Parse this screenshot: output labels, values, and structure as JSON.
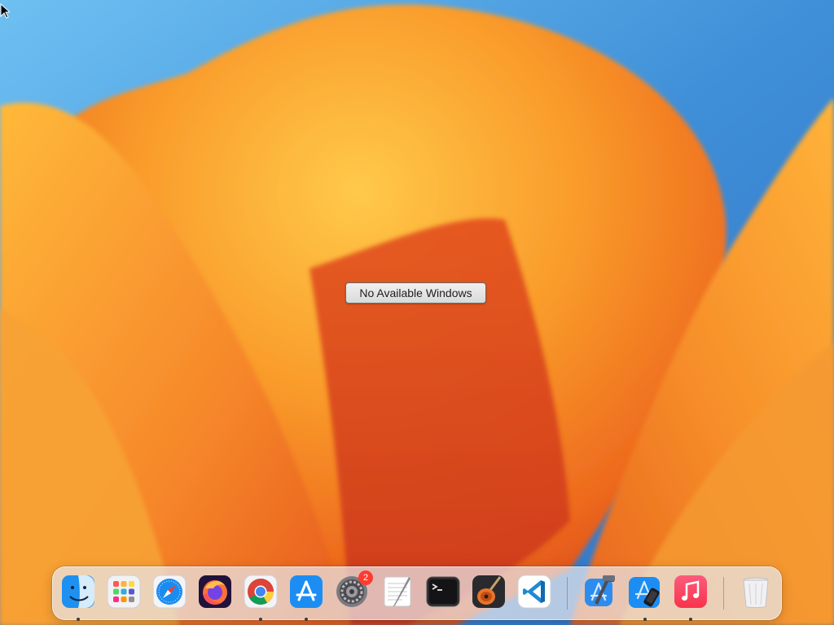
{
  "desktop": {
    "message": "No Available Windows"
  },
  "dock": {
    "apps": [
      {
        "id": "finder",
        "icon": "finder-icon",
        "running": true
      },
      {
        "id": "launchpad",
        "icon": "launchpad-icon",
        "running": false
      },
      {
        "id": "safari",
        "icon": "safari-icon",
        "running": false
      },
      {
        "id": "firefox",
        "icon": "firefox-icon",
        "running": false
      },
      {
        "id": "chrome",
        "icon": "chrome-icon",
        "running": true
      },
      {
        "id": "app-store",
        "icon": "app-store-icon",
        "running": true
      },
      {
        "id": "system-settings",
        "icon": "gear-icon",
        "running": false,
        "badge": "2"
      },
      {
        "id": "textedit",
        "icon": "textedit-icon",
        "running": false
      },
      {
        "id": "terminal",
        "icon": "terminal-icon",
        "running": false
      },
      {
        "id": "garageband",
        "icon": "guitar-icon",
        "running": false
      },
      {
        "id": "vscode",
        "icon": "vscode-icon",
        "running": false
      },
      {
        "id": "xcode",
        "icon": "hammer-icon",
        "running": false
      },
      {
        "id": "simulator",
        "icon": "simulator-icon",
        "running": true
      },
      {
        "id": "music",
        "icon": "music-note-icon",
        "running": true
      },
      {
        "id": "trash",
        "icon": "trash-icon",
        "running": false
      }
    ]
  },
  "colors": {
    "sky": "#3f8fd8",
    "petal_light": "#f9b13a",
    "petal_dark": "#e3561c",
    "dock_bg": "#e8e8ec",
    "badge": "#ff3b30"
  }
}
